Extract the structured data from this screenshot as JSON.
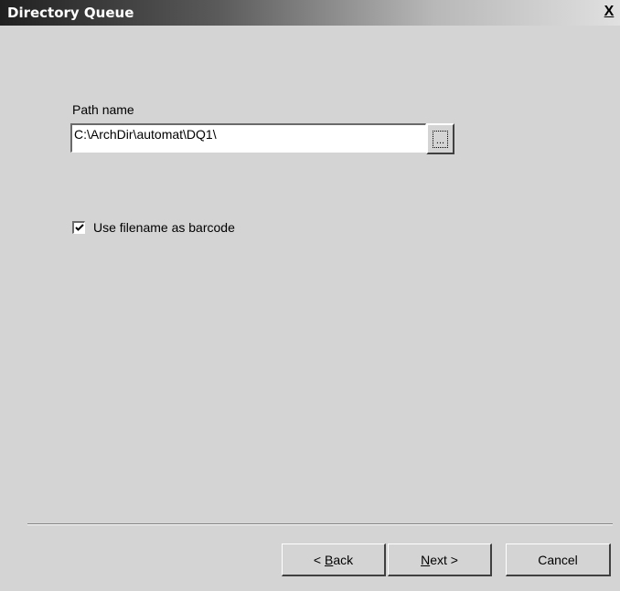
{
  "window": {
    "title": "Directory Queue",
    "close_symbol": "X"
  },
  "form": {
    "path_label": "Path name",
    "path_value": "C:\\ArchDir\\automat\\DQ1\\",
    "browse_label": "...",
    "barcode_checkbox_label": "Use filename as barcode",
    "barcode_checkbox_checked": true
  },
  "buttons": {
    "back_prefix": "< ",
    "back_mnemonic": "B",
    "back_rest": "ack",
    "next_mnemonic": "N",
    "next_rest": "ext >",
    "cancel": "Cancel"
  },
  "icons": {
    "close": "close-icon",
    "browse": "ellipsis-icon",
    "check": "checkmark-icon"
  }
}
